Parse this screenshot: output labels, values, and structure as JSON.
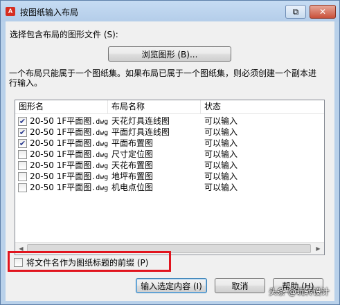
{
  "window": {
    "title": "按图纸输入布局",
    "help_button": "⧉",
    "close_button": "✕"
  },
  "select_file_label": "选择包含布局的图形文件 (S):",
  "browse_button": "浏览图形 (B)...",
  "info_text_line1": "一个布局只能属于一个图纸集。如果布局已属于一个图纸集，则必须创建一个副本进",
  "info_text_line2": "行输入。",
  "table": {
    "columns": [
      "图形名",
      "布局名称",
      "状态"
    ],
    "rows": [
      {
        "checked": true,
        "drawing": "20-50 1F平面图.dwg",
        "layout": "天花灯具连线图",
        "status": "可以输入"
      },
      {
        "checked": true,
        "drawing": "20-50 1F平面图.dwg",
        "layout": "平面灯具连线图",
        "status": "可以输入"
      },
      {
        "checked": true,
        "drawing": "20-50 1F平面图.dwg",
        "layout": "平面布置图",
        "status": "可以输入"
      },
      {
        "checked": false,
        "drawing": "20-50 1F平面图.dwg",
        "layout": "尺寸定位图",
        "status": "可以输入"
      },
      {
        "checked": false,
        "drawing": "20-50 1F平面图.dwg",
        "layout": "天花布置图",
        "status": "可以输入"
      },
      {
        "checked": false,
        "drawing": "20-50 1F平面图.dwg",
        "layout": "地坪布置图",
        "status": "可以输入"
      },
      {
        "checked": false,
        "drawing": "20-50 1F平面图.dwg",
        "layout": "机电点位图",
        "status": "可以输入"
      }
    ]
  },
  "prefix_checkbox_label": "将文件名作为图纸标题的前缀 (P)",
  "buttons": {
    "import": "输入选定内容 (I)",
    "cancel": "取消",
    "help": "帮助 (H)"
  },
  "watermark": "头条 @玩转设计"
}
